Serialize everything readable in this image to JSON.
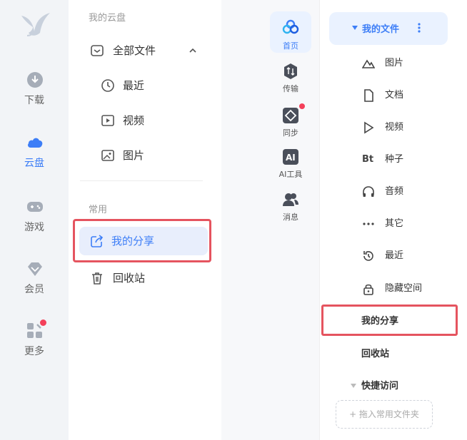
{
  "left_app": {
    "rail": [
      {
        "label": "下载",
        "icon": "download-icon"
      },
      {
        "label": "云盘",
        "icon": "cloud-icon",
        "active": true
      },
      {
        "label": "游戏",
        "icon": "gamepad-icon"
      },
      {
        "label": "会员",
        "icon": "diamond-icon"
      },
      {
        "label": "更多",
        "icon": "apps-icon",
        "badge": true
      }
    ],
    "section_cloud": "我的云盘",
    "all_files": "全部文件",
    "recent": "最近",
    "video": "视频",
    "pictures": "图片",
    "section_common": "常用",
    "my_share": "我的分享",
    "recycle_bin": "回收站"
  },
  "right_app": {
    "rail": [
      {
        "label": "首页",
        "icon": "cloud-logo-icon",
        "active": true
      },
      {
        "label": "传输",
        "icon": "transfer-icon"
      },
      {
        "label": "同步",
        "icon": "sync-icon",
        "badge": true
      },
      {
        "label": "AI工具",
        "icon": "ai-icon"
      },
      {
        "label": "消息",
        "icon": "message-icon"
      }
    ],
    "my_files": "我的文件",
    "file_types": [
      {
        "label": "图片",
        "icon": "mountain-icon"
      },
      {
        "label": "文档",
        "icon": "document-icon"
      },
      {
        "label": "视频",
        "icon": "play-icon"
      },
      {
        "label": "种子",
        "icon": "bt-icon",
        "glyph": "Bt"
      },
      {
        "label": "音频",
        "icon": "headphones-icon"
      },
      {
        "label": "其它",
        "icon": "ellipsis-icon"
      },
      {
        "label": "最近",
        "icon": "history-icon"
      },
      {
        "label": "隐藏空间",
        "icon": "lock-icon"
      }
    ],
    "my_share": "我的分享",
    "recycle_bin": "回收站",
    "quick_access": "快捷访问",
    "drag_hint": "+ 拖入常用文件夹"
  },
  "colors": {
    "accent": "#3d7ef7",
    "highlight": "#e5545f",
    "badge": "#f4405a"
  }
}
